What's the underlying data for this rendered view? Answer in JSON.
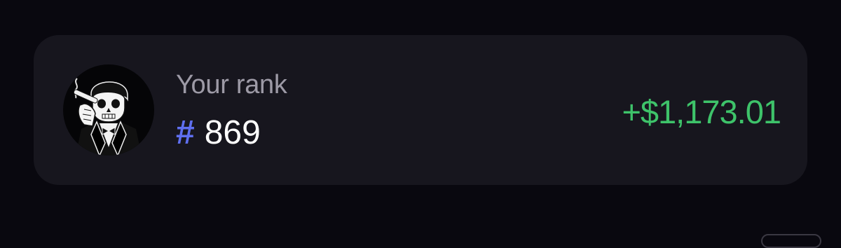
{
  "rank_card": {
    "label": "Your rank",
    "hash_symbol": "#",
    "rank": "869",
    "pnl": "+$1,173.01",
    "avatar_icon": "skull-smoking-cigar-avatar"
  },
  "colors": {
    "background": "#09080f",
    "card": "#17161e",
    "label": "#9d9aa6",
    "hash": "#5f6ff0",
    "rank_text": "#ffffff",
    "pnl": "#3ec36a"
  }
}
